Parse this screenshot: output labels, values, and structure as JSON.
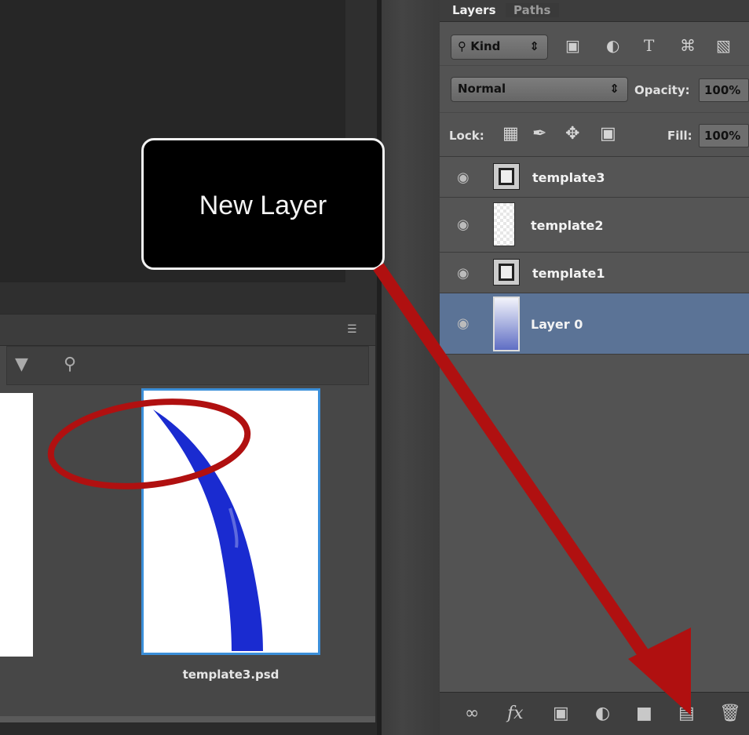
{
  "layers_panel": {
    "tabs": [
      "Layers",
      "Paths"
    ],
    "filter": {
      "label": "Kind",
      "icons": [
        "image-filter-icon",
        "adjustment-filter-icon",
        "type-filter-icon",
        "shape-filter-icon",
        "smart-object-filter-icon"
      ]
    },
    "blend_mode": "Normal",
    "opacity_label": "Opacity:",
    "opacity_value": "100%",
    "lock_label": "Lock:",
    "lock_icons": [
      "lock-transparent-icon",
      "lock-image-icon",
      "lock-position-icon",
      "lock-all-icon"
    ],
    "fill_label": "Fill:",
    "fill_value": "100%",
    "layers": [
      {
        "name": "template3",
        "type": "smart-object",
        "selected": false
      },
      {
        "name": "template2",
        "type": "transparent",
        "selected": false
      },
      {
        "name": "template1",
        "type": "smart-object",
        "selected": false
      },
      {
        "name": "Layer 0",
        "type": "gradient",
        "selected": true
      }
    ],
    "footer_icons": [
      "link-layers-icon",
      "layer-style-icon",
      "add-mask-icon",
      "adjustment-layer-icon",
      "new-group-icon",
      "new-layer-icon",
      "delete-layer-icon"
    ]
  },
  "mini_panel": {
    "toolbar_icons": [
      "filter-icon",
      "search-icon"
    ],
    "thumbnail_label": "template3.psd"
  },
  "callout": {
    "text": "New Layer"
  },
  "colors": {
    "arrow": "#b01010",
    "selection": "#5b7396",
    "thumb_border": "#3b8fd9",
    "stroke_blue": "#1a2bd0"
  }
}
